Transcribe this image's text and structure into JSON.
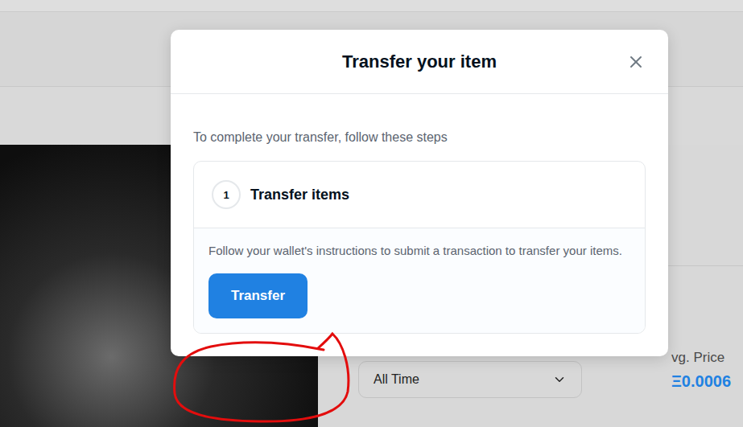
{
  "modal": {
    "title": "Transfer your item",
    "intro": "To complete your transfer, follow these steps",
    "steps": [
      {
        "number": "1",
        "title": "Transfer items",
        "expanded": true,
        "description": "Follow your wallet's instructions to submit a transaction to transfer your items.",
        "button": "Transfer"
      }
    ]
  },
  "background": {
    "period_select": "All Time",
    "stat_label": "vg. Price",
    "stat_value": "Ξ0.0006"
  }
}
